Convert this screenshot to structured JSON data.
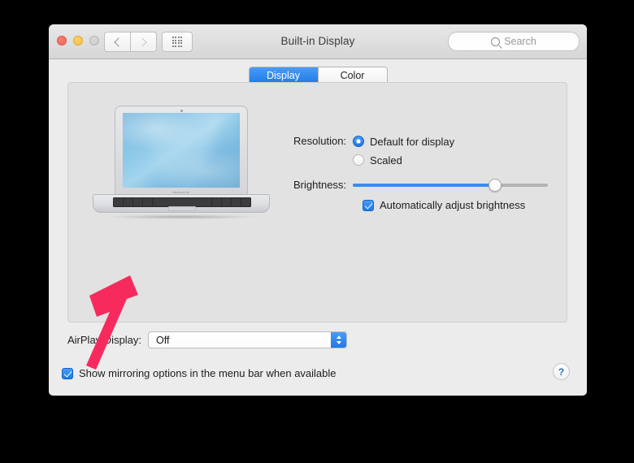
{
  "window": {
    "title": "Built-in Display",
    "traffic_lights": [
      "close-red",
      "minimize-yellow",
      "zoom-disabled-gray"
    ],
    "toolbar": {
      "back_icon": "chevron-left-icon",
      "forward_icon": "chevron-right-icon",
      "show_all_icon": "grid-dots-icon",
      "search": {
        "placeholder": "Search",
        "value": "",
        "icon": "search-icon"
      }
    }
  },
  "tabs": [
    {
      "label": "Display",
      "active": true
    },
    {
      "label": "Color",
      "active": false
    }
  ],
  "preview": {
    "device": "MacBook Air",
    "lid_label": "MacBook Air"
  },
  "resolution": {
    "label": "Resolution:",
    "options": [
      {
        "label": "Default for display",
        "selected": true
      },
      {
        "label": "Scaled",
        "selected": false
      }
    ]
  },
  "brightness": {
    "label": "Brightness:",
    "value_percent": 73,
    "auto_adjust": {
      "label": "Automatically adjust brightness",
      "checked": true
    }
  },
  "airplay": {
    "label": "AirPlay Display:",
    "value": "Off",
    "options": [
      "Off"
    ]
  },
  "mirroring": {
    "label": "Show mirroring options in the menu bar when available",
    "checked": true
  },
  "help": {
    "label": "?"
  },
  "annotation": {
    "type": "arrow",
    "color": "#f72a5e",
    "points_to": "show-mirroring-checkbox"
  },
  "colors": {
    "accent_blue": "#1d79e8",
    "window_bg": "#ececec",
    "panel_bg": "#e2e2e2",
    "page_bg": "#000000"
  }
}
